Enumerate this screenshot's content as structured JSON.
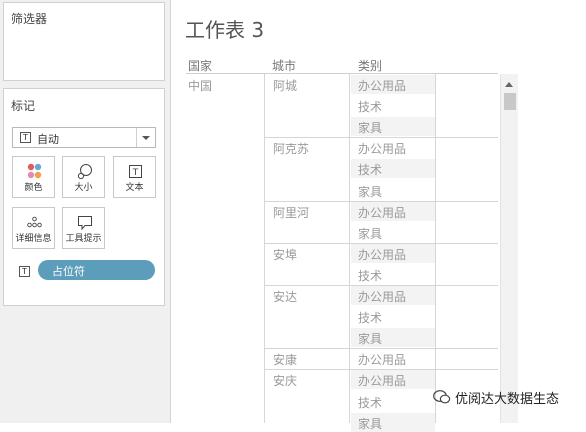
{
  "filters": {
    "title": "筛选器"
  },
  "marks": {
    "title": "标记",
    "mark_type": "自动",
    "buttons": {
      "color": "颜色",
      "size": "大小",
      "text": "文本",
      "detail": "详细信息",
      "tooltip": "工具提示"
    },
    "pill_label": "占位符",
    "icon_letter": "T"
  },
  "sheet": {
    "title": "工作表 3",
    "headers": {
      "country": "国家",
      "city": "城市",
      "category": "类别"
    },
    "country": "中国",
    "cities": [
      "阿城",
      "阿克苏",
      "阿里河",
      "安埠",
      "安达",
      "安康",
      "安庆"
    ],
    "categories": [
      "办公用品",
      "技术",
      "家具",
      "办公用品",
      "技术",
      "家具",
      "办公用品",
      "家具",
      "办公用品",
      "技术",
      "办公用品",
      "技术",
      "家具",
      "办公用品",
      "办公用品",
      "技术",
      "家具"
    ]
  },
  "watermark": "优阅达大数据生态",
  "colors": {
    "pill": "#5b9dbb",
    "band": "#f3f3f3"
  }
}
